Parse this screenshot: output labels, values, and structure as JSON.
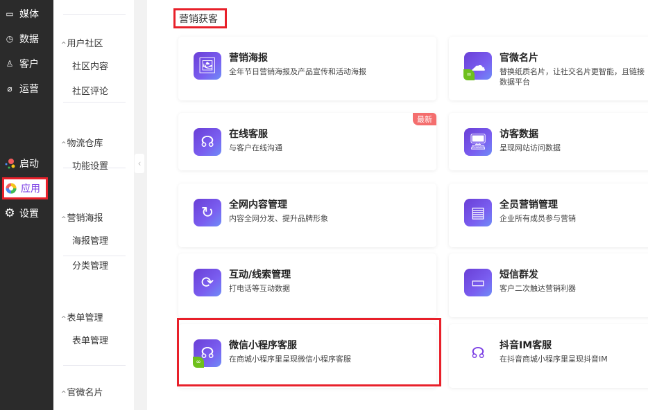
{
  "nav": {
    "items": [
      {
        "label": "媒体",
        "icon": "video-icon"
      },
      {
        "label": "数据",
        "icon": "pie-chart-icon"
      },
      {
        "label": "客户",
        "icon": "user-icon"
      },
      {
        "label": "运营",
        "icon": "paperclip-icon"
      },
      {
        "label": "启动",
        "icon": "launch-dots-icon"
      },
      {
        "label": "应用",
        "icon": "app-ring-icon",
        "active": true
      },
      {
        "label": "设置",
        "icon": "gear-icon"
      }
    ]
  },
  "submenu": {
    "groups": [
      {
        "label": "用户社区",
        "items": [
          "社区内容",
          "社区评论"
        ]
      },
      {
        "label": "物流仓库",
        "items": [
          "功能设置"
        ]
      },
      {
        "label": "营销海报",
        "items": [
          "海报管理",
          "分类管理"
        ]
      },
      {
        "label": "表单管理",
        "items": [
          "表单管理"
        ]
      },
      {
        "label": "官微名片",
        "items": []
      }
    ]
  },
  "section": {
    "title": "营销获客"
  },
  "cards": [
    {
      "title": "营销海报",
      "desc": "全年节日营销海报及产品宣传和活动海报",
      "icon": "image-icon"
    },
    {
      "title": "官微名片",
      "desc": "替换纸质名片，让社交名片更智能，且链接数据平台",
      "icon": "cloud-user-icon",
      "mini": true
    },
    {
      "title": "在线客服",
      "desc": "与客户在线沟通",
      "icon": "headset-icon",
      "badge": "最新"
    },
    {
      "title": "访客数据",
      "desc": "呈现网站访问数据",
      "icon": "monitor-user-icon"
    },
    {
      "title": "全网内容管理",
      "desc": "内容全网分发、提升品牌形象",
      "icon": "share-arrow-icon"
    },
    {
      "title": "全员营销管理",
      "desc": "企业所有成员参与营销",
      "icon": "id-card-chart-icon"
    },
    {
      "title": "互动/线索管理",
      "desc": "打电话等互动数据",
      "icon": "refresh-icon"
    },
    {
      "title": "短信群发",
      "desc": "客户二次触达营销利器",
      "icon": "message-icon"
    },
    {
      "title": "微信小程序客服",
      "desc": "在商城小程序里呈现微信小程序客服",
      "icon": "headset-icon",
      "mini": true
    },
    {
      "title": "抖音IM客服",
      "desc": "在抖音商城小程序里呈现抖音IM",
      "icon": "headset-purple-icon"
    }
  ]
}
